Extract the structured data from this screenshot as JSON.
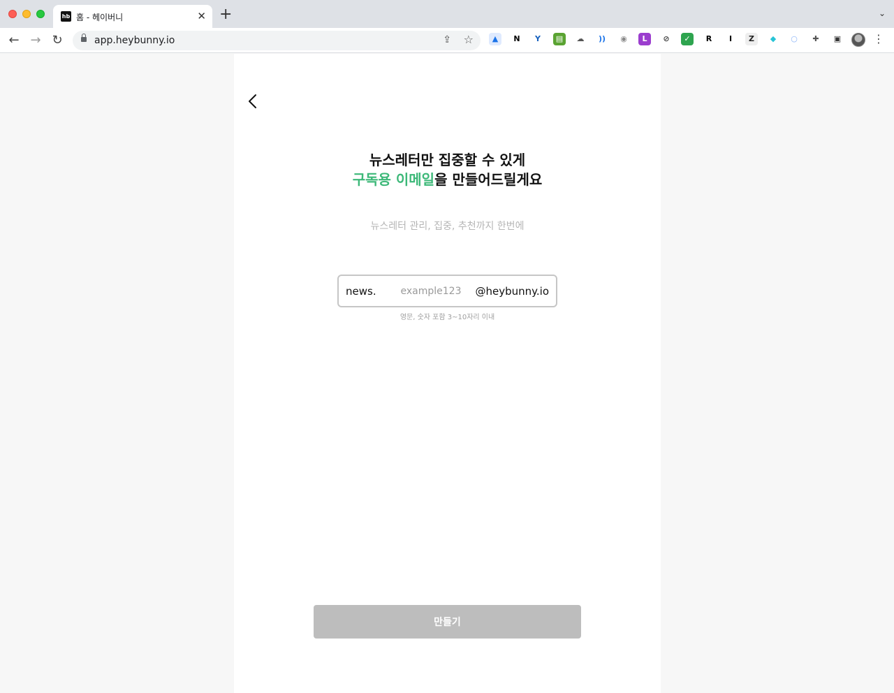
{
  "browser": {
    "tab_title": "홈 - 헤이버니",
    "favicon_text": "hb",
    "tab_close": "✕",
    "new_tab": "+",
    "tab_menu": "⌄",
    "url": "app.heybunny.io",
    "nav": {
      "back": "←",
      "forward": "→",
      "reload": "↻"
    },
    "omnibox_share": "⇪",
    "omnibox_star": "☆",
    "extension_menu": "⋮",
    "extensions": [
      {
        "name": "arc-extension-icon",
        "glyph": "▲",
        "color": "#1a73e8",
        "bg": "#dfeafe"
      },
      {
        "name": "notion-icon",
        "glyph": "N",
        "color": "#000000",
        "bg": "#ffffff"
      },
      {
        "name": "y-extension-icon",
        "glyph": "Y",
        "color": "#1560bd",
        "bg": "#ffffff"
      },
      {
        "name": "printer-extension-icon",
        "glyph": "▤",
        "color": "#ffffff",
        "bg": "#5aa332"
      },
      {
        "name": "cloud-icon",
        "glyph": "☁",
        "color": "#555555",
        "bg": "#ffffff"
      },
      {
        "name": "wave-extension-icon",
        "glyph": "))",
        "color": "#1a73e8",
        "bg": "#ffffff"
      },
      {
        "name": "camera-icon",
        "glyph": "◉",
        "color": "#888888",
        "bg": "#ffffff"
      },
      {
        "name": "translate-extension-icon",
        "glyph": "L",
        "color": "#ffffff",
        "bg": "#9b3dce"
      },
      {
        "name": "circle-slash-icon",
        "glyph": "⊘",
        "color": "#444444",
        "bg": "#ffffff"
      },
      {
        "name": "checkmark-extension-icon",
        "glyph": "✓",
        "color": "#ffffff",
        "bg": "#2ea44f"
      },
      {
        "name": "r-extension-icon",
        "glyph": "R",
        "color": "#000000",
        "bg": "#ffffff"
      },
      {
        "name": "i-extension-icon",
        "glyph": "I",
        "color": "#000000",
        "bg": "#ffffff"
      },
      {
        "name": "z-extension-icon",
        "glyph": "Z",
        "color": "#222222",
        "bg": "#eeeeee"
      },
      {
        "name": "cap-extension-icon",
        "glyph": "◆",
        "color": "#27c4d6",
        "bg": "#ffffff"
      },
      {
        "name": "ring-extension-icon",
        "glyph": "○",
        "color": "#8ab4f8",
        "bg": "#ffffff"
      },
      {
        "name": "puzzle-icon",
        "glyph": "✚",
        "color": "#555555",
        "bg": "#ffffff"
      },
      {
        "name": "side-panel-icon",
        "glyph": "▣",
        "color": "#333333",
        "bg": "#ffffff"
      }
    ]
  },
  "page": {
    "headline_line1": "뉴스레터만 집중할 수 있게",
    "headline_line2_highlight": "구독용 이메일",
    "headline_line2_rest": "을 만들어드릴게요",
    "subtitle": "뉴스레터 관리, 집중, 추천까지 한번에",
    "email": {
      "prefix": "news.",
      "placeholder": "example123",
      "value": "",
      "domain": "@heybunny.io"
    },
    "hint": "영문, 숫자 포함 3~10자리 이내",
    "create_button": "만들기"
  },
  "colors": {
    "accent_green": "#3cb878",
    "button_disabled": "#bdbdbd",
    "page_background": "#f7f7f7"
  }
}
